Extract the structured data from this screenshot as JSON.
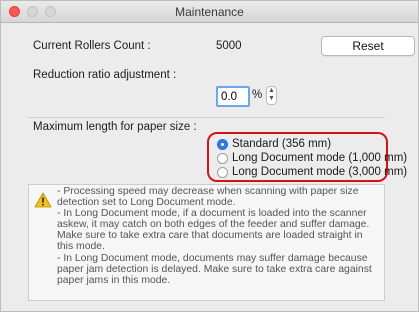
{
  "window": {
    "title": "Maintenance"
  },
  "rollers": {
    "label": "Current Rollers Count :",
    "value": "5000",
    "reset_label": "Reset"
  },
  "reduction": {
    "label": "Reduction ratio adjustment :",
    "value": "0.0",
    "unit": "%"
  },
  "paper_size": {
    "label": "Maximum length for paper size :",
    "options": [
      {
        "label": "Standard (356 mm)",
        "selected": true
      },
      {
        "label": "Long Document mode (1,000 mm)",
        "selected": false
      },
      {
        "label": "Long Document mode (3,000 mm)",
        "selected": false
      }
    ]
  },
  "notes": {
    "icon": "warning-icon",
    "lines": [
      "- Processing speed may decrease when scanning with paper size",
      "detection set to Long Document mode.",
      "- In Long Document mode, if a document is loaded into the scanner",
      "askew, it may catch on both edges of the feeder and suffer damage.",
      "Make sure to take extra care that documents are loaded straight in",
      "this mode.",
      "- In Long Document mode, documents may suffer damage because",
      "paper jam detection is delayed. Make sure to take extra care against",
      "paper jams in this mode."
    ]
  },
  "colors": {
    "highlight_border": "#d4121a",
    "radio_selected": "#2f7ae5",
    "input_focus": "#6aa7ec"
  }
}
